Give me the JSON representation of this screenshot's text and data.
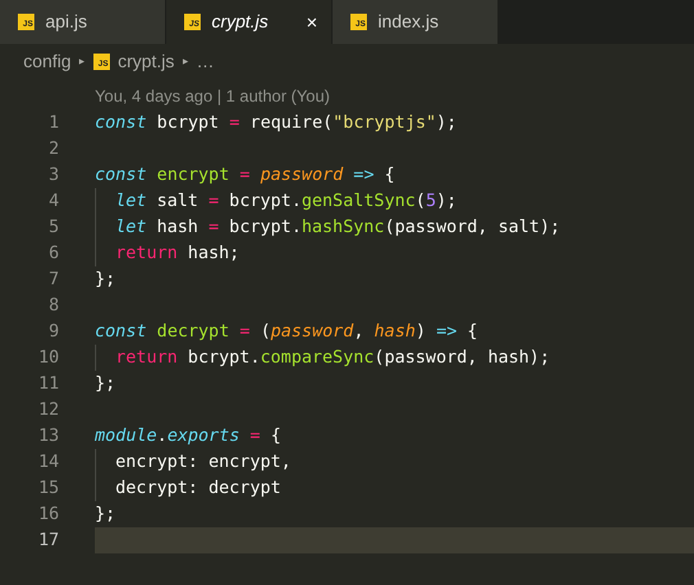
{
  "tabs": [
    {
      "label": "api.js",
      "icon_label": "JS",
      "selected": false,
      "preview": false
    },
    {
      "label": "crypt.js",
      "icon_label": "JS",
      "selected": true,
      "preview": true,
      "close": "×"
    },
    {
      "label": "index.js",
      "icon_label": "JS",
      "selected": false,
      "preview": false
    }
  ],
  "breadcrumb": {
    "folder": "config",
    "separator": "▸",
    "file": {
      "label": "crypt.js",
      "icon_label": "JS"
    },
    "more": "…"
  },
  "codelens": "You, 4 days ago | 1 author (You)",
  "lines": [
    {
      "number": "1",
      "current": false,
      "indented": false,
      "tokens": [
        {
          "text": "const",
          "kind": "keyword"
        },
        {
          "text": " bcrypt ",
          "kind": "plain"
        },
        {
          "text": "=",
          "kind": "operator"
        },
        {
          "text": " require",
          "kind": "plain"
        },
        {
          "text": "(",
          "kind": "plain"
        },
        {
          "text": "\"bcryptjs\"",
          "kind": "string"
        },
        {
          "text": ");",
          "kind": "plain"
        }
      ]
    },
    {
      "number": "2",
      "current": false,
      "indented": false
    },
    {
      "number": "3",
      "current": false,
      "indented": false,
      "tokens": [
        {
          "text": "const",
          "kind": "keyword"
        },
        {
          "text": " encrypt",
          "kind": "function"
        },
        {
          "text": " =",
          "kind": "operator"
        },
        {
          "text": " password",
          "kind": "param"
        },
        {
          "text": " =>",
          "kind": "keyword-plain"
        },
        {
          "text": " {",
          "kind": "plain"
        }
      ]
    },
    {
      "number": "4",
      "current": false,
      "indented": true,
      "tokens": [
        {
          "text": "let",
          "kind": "keyword"
        },
        {
          "text": " salt ",
          "kind": "plain"
        },
        {
          "text": "=",
          "kind": "operator"
        },
        {
          "text": " bcrypt.",
          "kind": "plain"
        },
        {
          "text": "genSaltSync",
          "kind": "function"
        },
        {
          "text": "(",
          "kind": "plain"
        },
        {
          "text": "5",
          "kind": "number"
        },
        {
          "text": ");",
          "kind": "plain"
        }
      ]
    },
    {
      "number": "5",
      "current": false,
      "indented": true,
      "tokens": [
        {
          "text": "let",
          "kind": "keyword"
        },
        {
          "text": " hash ",
          "kind": "plain"
        },
        {
          "text": "=",
          "kind": "operator"
        },
        {
          "text": " bcrypt.",
          "kind": "plain"
        },
        {
          "text": "hashSync",
          "kind": "function"
        },
        {
          "text": "(password, salt);",
          "kind": "plain"
        }
      ]
    },
    {
      "number": "6",
      "current": false,
      "indented": true,
      "tokens": [
        {
          "text": "return",
          "kind": "control"
        },
        {
          "text": " hash;",
          "kind": "plain"
        }
      ]
    },
    {
      "number": "7",
      "current": false,
      "indented": false,
      "tokens": [
        {
          "text": "};",
          "kind": "plain"
        }
      ]
    },
    {
      "number": "8",
      "current": false,
      "indented": false
    },
    {
      "number": "9",
      "current": false,
      "indented": false,
      "tokens": [
        {
          "text": "const",
          "kind": "keyword"
        },
        {
          "text": " decrypt",
          "kind": "function"
        },
        {
          "text": " =",
          "kind": "operator"
        },
        {
          "text": " (",
          "kind": "plain"
        },
        {
          "text": "password",
          "kind": "param"
        },
        {
          "text": ", ",
          "kind": "plain"
        },
        {
          "text": "hash",
          "kind": "param"
        },
        {
          "text": ") ",
          "kind": "plain"
        },
        {
          "text": "=>",
          "kind": "keyword-plain"
        },
        {
          "text": " {",
          "kind": "plain"
        }
      ]
    },
    {
      "number": "10",
      "current": false,
      "indented": true,
      "tokens": [
        {
          "text": "return",
          "kind": "control"
        },
        {
          "text": " bcrypt.",
          "kind": "plain"
        },
        {
          "text": "compareSync",
          "kind": "function"
        },
        {
          "text": "(password, hash);",
          "kind": "plain"
        }
      ]
    },
    {
      "number": "11",
      "current": false,
      "indented": false,
      "tokens": [
        {
          "text": "};",
          "kind": "plain"
        }
      ]
    },
    {
      "number": "12",
      "current": false,
      "indented": false
    },
    {
      "number": "13",
      "current": false,
      "indented": false,
      "tokens": [
        {
          "text": "module",
          "kind": "keyword"
        },
        {
          "text": ".",
          "kind": "plain"
        },
        {
          "text": "exports",
          "kind": "keyword"
        },
        {
          "text": " =",
          "kind": "operator"
        },
        {
          "text": " {",
          "kind": "plain"
        }
      ]
    },
    {
      "number": "14",
      "current": false,
      "indented": true,
      "tokens": [
        {
          "text": "encrypt: encrypt,",
          "kind": "plain"
        }
      ]
    },
    {
      "number": "15",
      "current": false,
      "indented": true,
      "tokens": [
        {
          "text": "decrypt: decrypt",
          "kind": "plain"
        }
      ]
    },
    {
      "number": "16",
      "current": false,
      "indented": false,
      "tokens": [
        {
          "text": "};",
          "kind": "plain"
        }
      ]
    },
    {
      "number": "17",
      "current": true,
      "indented": false
    }
  ]
}
